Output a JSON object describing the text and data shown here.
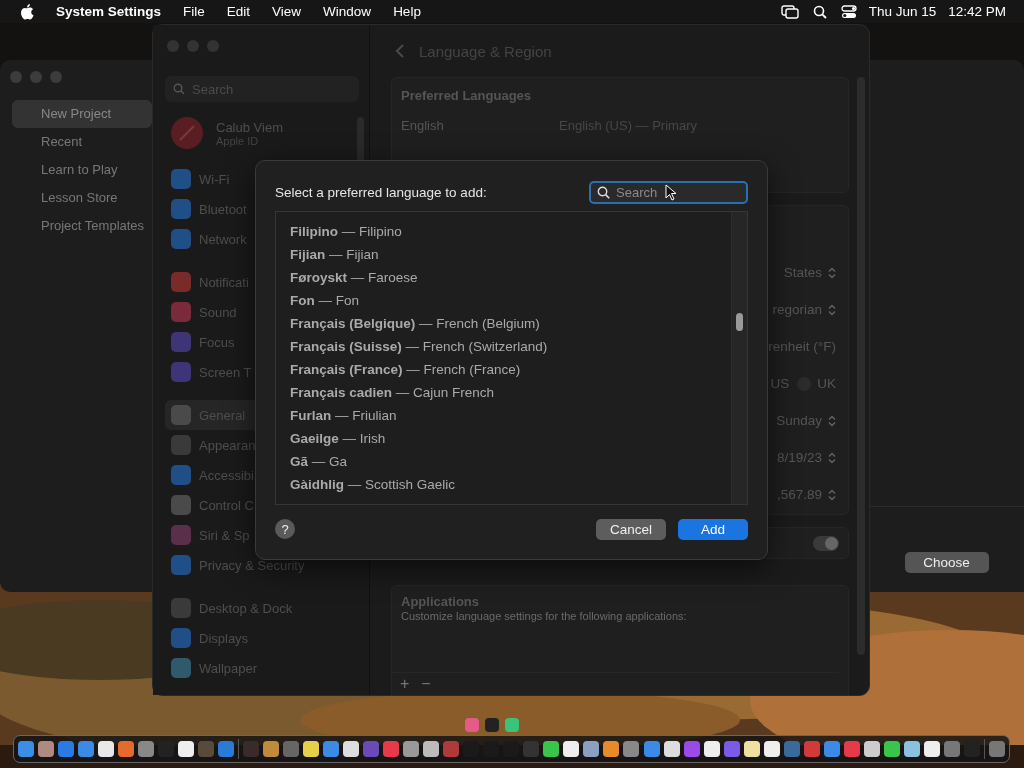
{
  "menu_bar": {
    "app_name": "System Settings",
    "menus": [
      "File",
      "Edit",
      "View",
      "Window",
      "Help"
    ],
    "date": "Thu Jun 15",
    "time": "12:42 PM"
  },
  "back_window": {
    "sidebar": [
      {
        "label": "New Project",
        "selected": true
      },
      {
        "label": "Recent",
        "selected": false
      },
      {
        "label": "Learn to Play",
        "selected": false
      },
      {
        "label": "Lesson Store",
        "selected": false
      },
      {
        "label": "Project Templates",
        "selected": false
      }
    ],
    "choose_button": "Choose"
  },
  "settings": {
    "search": {
      "placeholder": "Search"
    },
    "account": {
      "name": "Calub Viem",
      "subtitle": "Apple ID"
    },
    "sidebar_groups": [
      {
        "items": [
          {
            "label": "Wi-Fi",
            "selected": false,
            "color": "#1f4f86"
          },
          {
            "label": "Bluetoot",
            "selected": false,
            "color": "#1f4f86"
          },
          {
            "label": "Network",
            "selected": false,
            "color": "#1f4f86"
          }
        ]
      },
      {
        "items": [
          {
            "label": "Notificati",
            "selected": false,
            "color": "#7a2a2a"
          },
          {
            "label": "Sound",
            "selected": false,
            "color": "#7a2a3a"
          },
          {
            "label": "Focus",
            "selected": false,
            "color": "#3e3478"
          },
          {
            "label": "Screen T",
            "selected": false,
            "color": "#3e3478"
          }
        ]
      },
      {
        "items": [
          {
            "label": "General",
            "selected": true,
            "color": "#4a4a4a"
          },
          {
            "label": "Appearan",
            "selected": false,
            "color": "#3a3a3a"
          },
          {
            "label": "Accessibi",
            "selected": false,
            "color": "#1f4f86"
          },
          {
            "label": "Control C",
            "selected": false,
            "color": "#4a4a4a"
          },
          {
            "label": "Siri & Sp",
            "selected": false,
            "color": "#5a2f4a"
          },
          {
            "label": "Privacy & Security",
            "selected": false,
            "color": "#1f4f86"
          }
        ]
      },
      {
        "items": [
          {
            "label": "Desktop & Dock",
            "selected": false,
            "color": "#3a3a3a"
          },
          {
            "label": "Displays",
            "selected": false,
            "color": "#1f4f86"
          },
          {
            "label": "Wallpaper",
            "selected": false,
            "color": "#2f5a6a"
          }
        ]
      }
    ],
    "title": "Language & Region",
    "preferred_languages": {
      "heading": "Preferred Languages",
      "language": "English",
      "detail": "English (US) — Primary"
    },
    "region_rows": [
      {
        "kind": "popup",
        "value": "States"
      },
      {
        "kind": "popup",
        "value": "regorian"
      },
      {
        "kind": "text",
        "value": "renheit (°F)"
      },
      {
        "kind": "radio",
        "value": "US",
        "option": {
          "label": "UK",
          "selected": false
        }
      },
      {
        "kind": "popup",
        "value": "Sunday"
      },
      {
        "kind": "popup",
        "value": "8/19/23"
      },
      {
        "kind": "popup",
        "value": ",567.89"
      }
    ],
    "toggle": {
      "on": true
    },
    "applications": {
      "heading": "Applications",
      "description": "Customize language settings for the following applications:",
      "buttons": [
        "+",
        "−"
      ]
    }
  },
  "dialog": {
    "prompt": "Select a preferred language to add:",
    "search": {
      "placeholder": "Search"
    },
    "languages": [
      {
        "label": "**Filipino** — Filipino",
        "selected": false
      },
      {
        "label": "**Fijian** — Fijian",
        "selected": false
      },
      {
        "label": "**Føroyskt** — Faroese",
        "selected": false
      },
      {
        "label": "**Fon** — Fon",
        "selected": false
      },
      {
        "label": "**Français (Belgique)** — French (Belgium)",
        "selected": false
      },
      {
        "label": "**Français (Suisse)** — French (Switzerland)",
        "selected": false
      },
      {
        "label": "**Français (France)** — French (France)",
        "selected": false
      },
      {
        "label": "**Français cadien** — Cajun French",
        "selected": false
      },
      {
        "label": "**Furlan** — Friulian",
        "selected": false
      },
      {
        "label": "**Gaeilge** — Irish",
        "selected": false
      },
      {
        "label": "**Gã** — Ga",
        "selected": false
      },
      {
        "label": "**Gàidhlig** — Scottish Gaelic",
        "selected": false
      }
    ],
    "help": "?",
    "buttons": [
      {
        "label": "Cancel",
        "kind": "cancel"
      },
      {
        "label": "Add",
        "kind": "default"
      }
    ]
  }
}
